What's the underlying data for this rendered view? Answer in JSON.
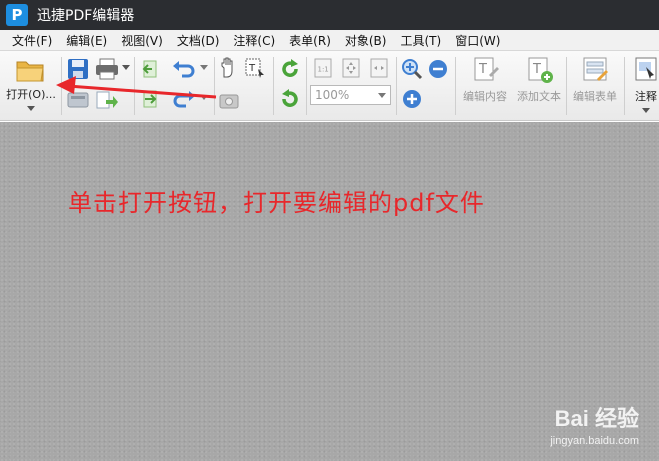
{
  "app": {
    "logo_letter": "P",
    "title": "迅捷PDF编辑器"
  },
  "menu": [
    "文件(F)",
    "编辑(E)",
    "视图(V)",
    "文档(D)",
    "注释(C)",
    "表单(R)",
    "对象(B)",
    "工具(T)",
    "窗口(W)"
  ],
  "toolbar": {
    "open_label": "打开(O)...",
    "zoom_value": "100%",
    "edit_content_label": "编辑内容",
    "add_text_label": "添加文本",
    "edit_form_label": "编辑表单",
    "annotate_label": "注释"
  },
  "annotation": {
    "text": "单击打开按钮，打开要编辑的pdf文件",
    "color": "#e8272b"
  },
  "watermark": {
    "brand": "Bai 经验",
    "url": "jingyan.baidu.com"
  },
  "colors": {
    "titlebar": "#2b2d31",
    "accent": "#1d8ee0",
    "workspace": "#a8a8a8"
  }
}
